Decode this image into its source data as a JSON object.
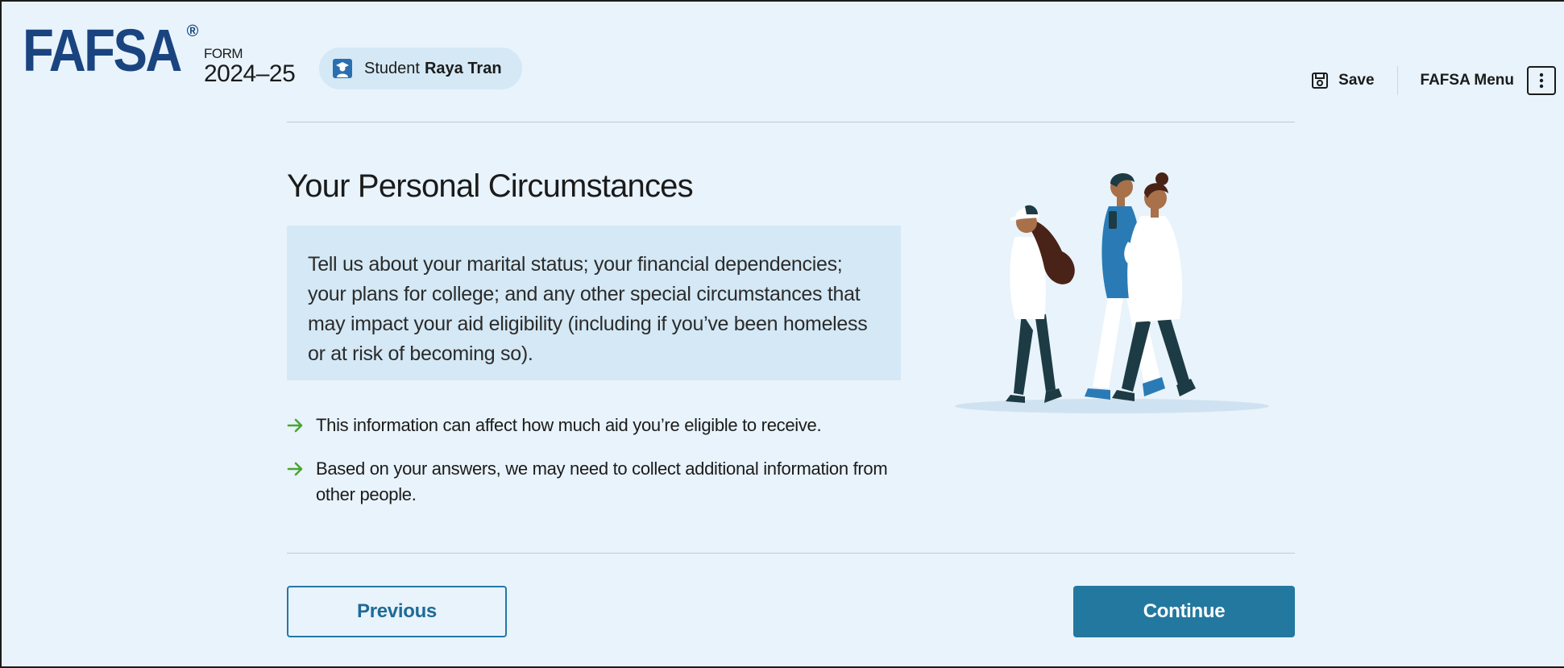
{
  "header": {
    "logo_text": "FAFSA",
    "logo_mark": "®",
    "form_label": "FORM",
    "form_year": "2024–25",
    "student": {
      "icon": "student-icon",
      "role_label": "Student",
      "name": "Raya Tran"
    },
    "save_label": "Save",
    "save_icon": "save-icon",
    "menu_label": "FAFSA Menu",
    "menu_icon": "kebab-menu-icon"
  },
  "main": {
    "title": "Your Personal Circumstances",
    "intro": "Tell us about your marital status; your financial dependencies; your plans for college; and any other special circumstances that may impact your aid eligibility (including if you’ve been homeless or at risk of becoming so).",
    "bullets": [
      "This information can affect how much aid you’re eligible to receive.",
      "Based on your answers, we may need to collect additional information from other people."
    ],
    "bullet_icon": "arrow-right-icon",
    "illustration": "people-walking-illustration"
  },
  "footer": {
    "previous_label": "Previous",
    "continue_label": "Continue"
  },
  "colors": {
    "background": "#e8f3fb",
    "brand": "#1a4480",
    "panel": "#d4e8f5",
    "primary_button": "#23789f",
    "arrow": "#4aa52e"
  }
}
